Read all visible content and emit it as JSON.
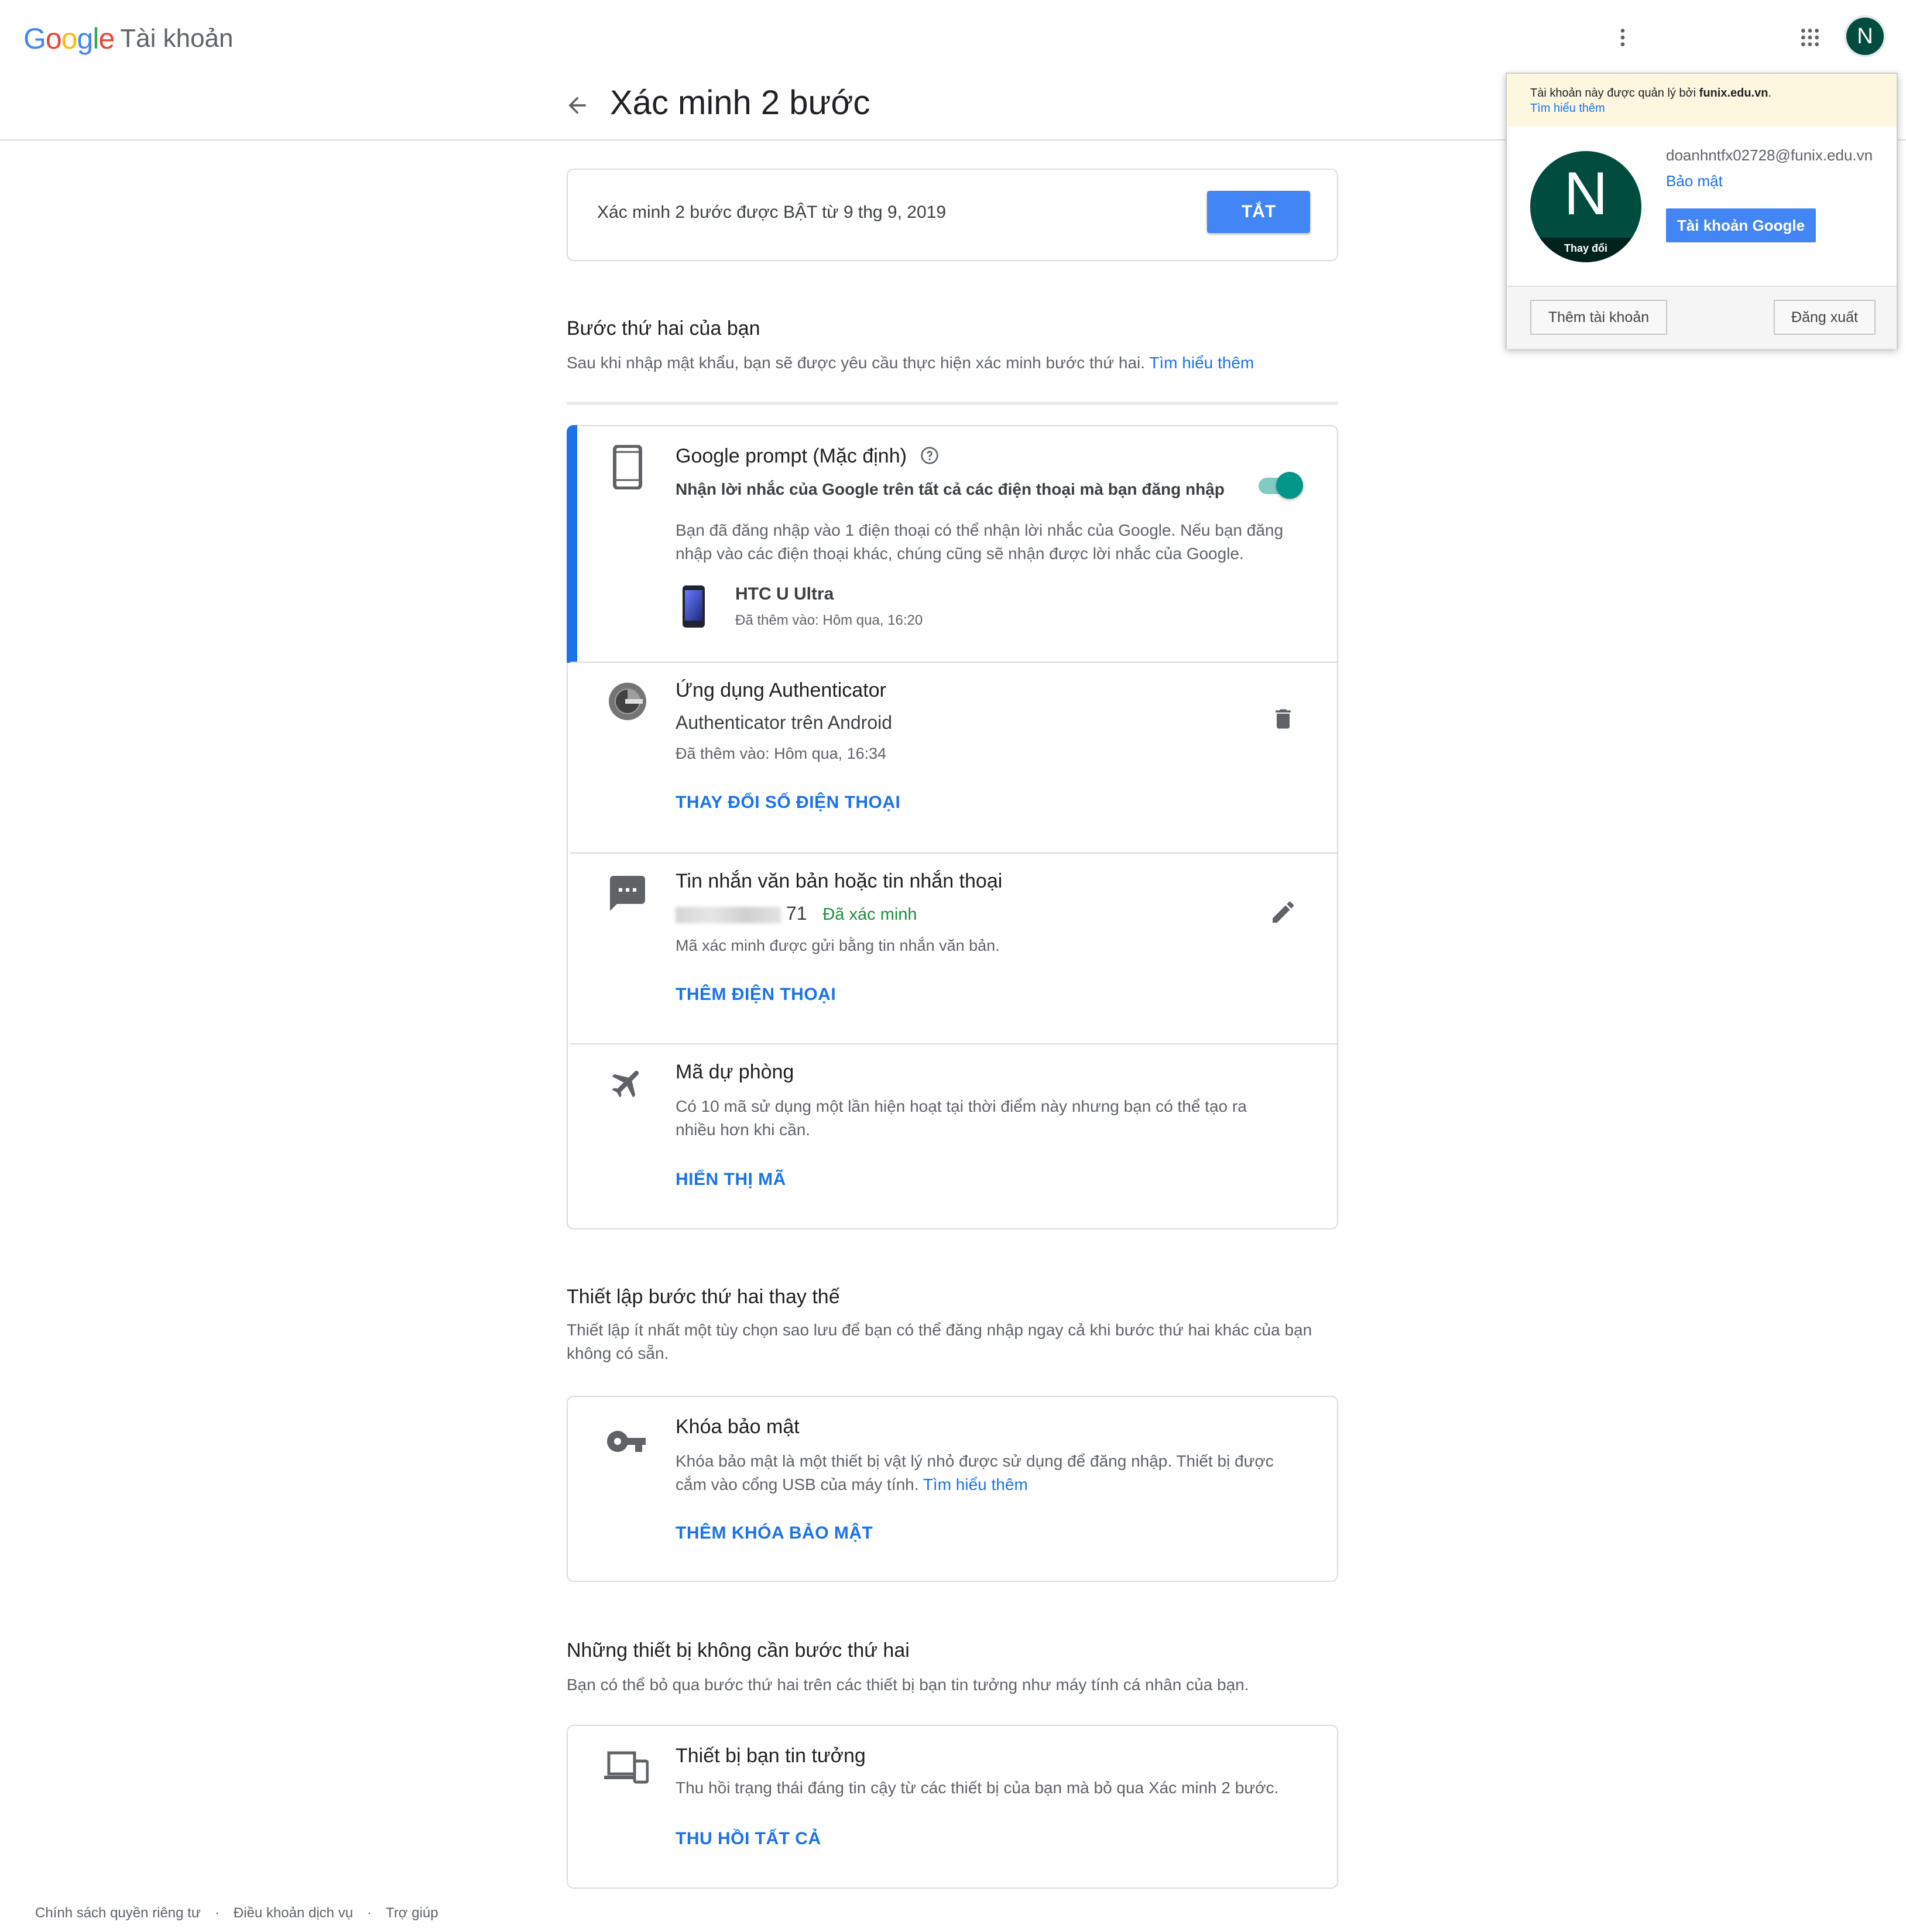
{
  "header": {
    "logo": "Google",
    "product": "Tài khoản",
    "page_title": "Xác minh 2 bước",
    "avatar_letter": "N"
  },
  "popup": {
    "notice_prefix": "Tài khoản này được quản lý bởi ",
    "notice_domain": "funix.edu.vn",
    "notice_suffix": ".",
    "notice_link": "Tìm hiểu thêm",
    "avatar_letter": "N",
    "avatar_change": "Thay đổi",
    "email": "doanhntfx02728@funix.edu.vn",
    "security_link": "Bảo mật",
    "account_button": "Tài khoản Google",
    "add_account": "Thêm tài khoản",
    "sign_out": "Đăng xuất"
  },
  "status": {
    "text": "Xác minh 2 bước được BẬT từ 9 thg 9, 2019",
    "off_button": "TẮT"
  },
  "second_step": {
    "title": "Bước thứ hai của bạn",
    "desc": "Sau khi nhập mật khẩu, bạn sẽ được yêu cầu thực hiện xác minh bước thứ hai.",
    "learn_more": "Tìm hiểu thêm"
  },
  "prompt": {
    "title": "Google prompt (Mặc định)",
    "subtitle": "Nhận lời nhắc của Google trên tất cả các điện thoại mà bạn đăng nhập",
    "desc": "Bạn đã đăng nhập vào 1 điện thoại có thể nhận lời nhắc của Google. Nếu bạn đăng nhập vào các điện thoại khác, chúng cũng sẽ nhận được lời nhắc của Google.",
    "device_name": "HTC U Ultra",
    "device_added": "Đã thêm vào: Hôm qua, 16:20",
    "enabled": true
  },
  "authenticator": {
    "title": "Ứng dụng Authenticator",
    "subtitle": "Authenticator trên Android",
    "added": "Đã thêm vào: Hôm qua, 16:34",
    "action": "THAY ĐỔI SỐ ĐIỆN THOẠI"
  },
  "sms": {
    "title": "Tin nhắn văn bản hoặc tin nhắn thoại",
    "phone_suffix": "71",
    "verified": "Đã xác minh",
    "desc": "Mã xác minh được gửi bằng tin nhắn văn bản.",
    "action": "THÊM ĐIỆN THOẠI"
  },
  "backup": {
    "title": "Mã dự phòng",
    "desc": "Có 10 mã sử dụng một lần hiện hoạt tại thời điểm này nhưng bạn có thể tạo ra nhiều hơn khi cần.",
    "action": "HIỂN THỊ MÃ"
  },
  "alternate": {
    "title": "Thiết lập bước thứ hai thay thế",
    "desc": "Thiết lập ít nhất một tùy chọn sao lưu để bạn có thể đăng nhập ngay cả khi bước thứ hai khác của bạn không có sẵn."
  },
  "security_key": {
    "title": "Khóa bảo mật",
    "desc": "Khóa bảo mật là một thiết bị vật lý nhỏ được sử dụng để đăng nhập. Thiết bị được cắm vào cổng USB của máy tính.",
    "learn_more": "Tìm hiểu thêm",
    "action": "THÊM KHÓA BẢO MẬT"
  },
  "trusted_section": {
    "title": "Những thiết bị không cần bước thứ hai",
    "desc": "Bạn có thể bỏ qua bước thứ hai trên các thiết bị bạn tin tưởng như máy tính cá nhân của bạn."
  },
  "trusted": {
    "title": "Thiết bị bạn tin tưởng",
    "desc": "Thu hồi trạng thái đáng tin cậy từ các thiết bị của bạn mà bỏ qua Xác minh 2 bước.",
    "action": "THU HỒI TẤT CẢ"
  },
  "footer": {
    "privacy": "Chính sách quyền riêng tư",
    "terms": "Điều khoản dịch vụ",
    "help": "Trợ giúp",
    "separator": "·"
  },
  "colors": {
    "accent": "#1a73e8",
    "button": "#4285f4",
    "toggle": "#009688",
    "verified": "#1e8e3e",
    "avatar": "#004d40",
    "active_bar": "#1a73e8"
  }
}
